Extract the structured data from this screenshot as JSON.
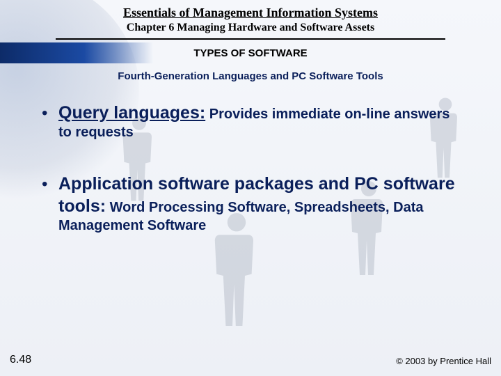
{
  "header": {
    "book_title": "Essentials of Management Information Systems",
    "chapter": "Chapter 6 Managing Hardware and Software Assets",
    "section": "TYPES OF SOFTWARE",
    "subtitle": "Fourth-Generation Languages and PC Software Tools"
  },
  "bullets": [
    {
      "lead": "Query languages:",
      "rest": " Provides immediate on-line answers to requests"
    },
    {
      "lead": "Application software packages and PC software tools:",
      "rest": " Word Processing Software, Spreadsheets, Data Management Software"
    }
  ],
  "footer": {
    "page": "6.48",
    "copyright": "© 2003 by Prentice Hall"
  }
}
